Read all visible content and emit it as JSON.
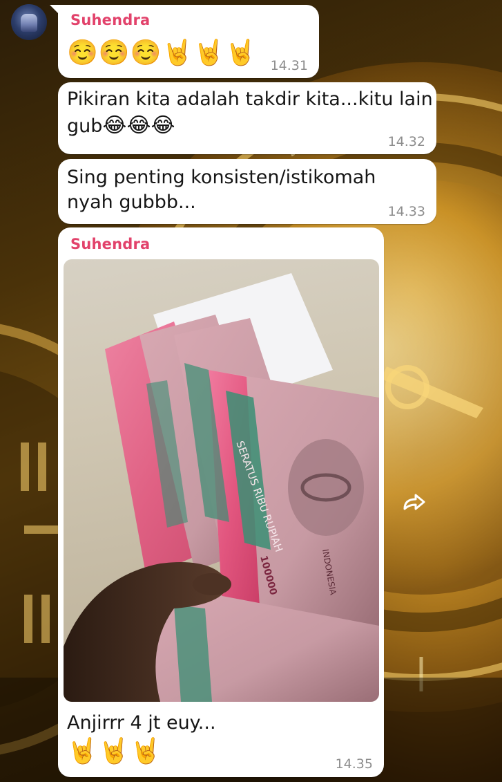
{
  "colors": {
    "sender_name": "#e2426b",
    "bubble_bg": "#ffffff",
    "timestamp": "#8d8d8d",
    "message_text": "#161616"
  },
  "messages": [
    {
      "sender": "Suhendra",
      "emojis": "☺️☺️☺️🤘🤘🤘",
      "time": "14.31"
    },
    {
      "line1": "Pikiran kita adalah takdir kita...kitu lain",
      "line2_text": "gub",
      "line2_emojis": "😂😂😂",
      "time": "14.32"
    },
    {
      "line1": "Sing penting konsisten/istikomah",
      "line2": "nyah gubbb...",
      "time": "14.33"
    },
    {
      "sender": "Suhendra",
      "photo_icon": "photo-money-icon",
      "caption": "Anjirrr 4 jt euy...",
      "emojis": "🤘🤘🤘",
      "time": "14.35"
    }
  ],
  "photo_banknote_text": {
    "denomination": "SERATUS RIBU RUPIAH",
    "amount": "100000",
    "country": "INDONESIA"
  },
  "icons": {
    "avatar": "avatar",
    "forward": "forward-icon"
  }
}
